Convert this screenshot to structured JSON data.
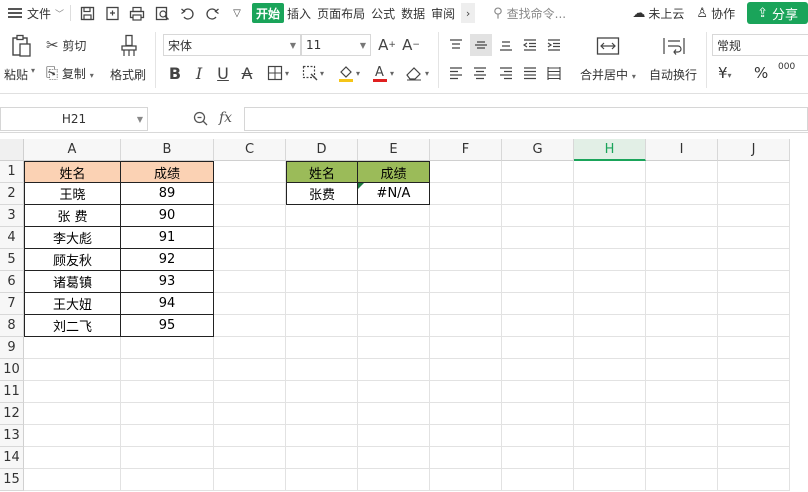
{
  "menubar": {
    "file_label": "文件",
    "tabs": [
      {
        "label": "开始",
        "active": true
      },
      {
        "label": "插入",
        "active": false
      },
      {
        "label": "页面布局",
        "active": false
      },
      {
        "label": "公式",
        "active": false
      },
      {
        "label": "数据",
        "active": false
      },
      {
        "label": "审阅",
        "active": false
      }
    ],
    "search_placeholder": "查找命令...",
    "cloud_label": "未上云",
    "collab_label": "协作",
    "share_label": "分享",
    "accent_color": "#1aa45a"
  },
  "ribbon": {
    "paste_label": "粘贴",
    "cut_label": "剪切",
    "copy_label": "复制",
    "format_painter_label": "格式刷",
    "font_name": "宋体",
    "font_size": "11",
    "merge_label": "合并居中",
    "wrap_label": "自动换行",
    "number_format": "常规",
    "currency_symbol": "¥",
    "percent_symbol": "%",
    "thousands_symbol": "000"
  },
  "formula_bar": {
    "name_box": "H21",
    "fx": "fx",
    "formula": ""
  },
  "sheet": {
    "columns": [
      "A",
      "B",
      "C",
      "D",
      "E",
      "F",
      "G",
      "H",
      "I",
      "J"
    ],
    "selected_column": "H",
    "rows": [
      "1",
      "2",
      "3",
      "4",
      "5",
      "6",
      "7",
      "8",
      "9",
      "10",
      "11",
      "12",
      "13",
      "14",
      "15"
    ],
    "table1": {
      "header": [
        "姓名",
        "成绩"
      ],
      "rows": [
        [
          "王晓",
          "89"
        ],
        [
          "张 费",
          "90"
        ],
        [
          "李大彪",
          "91"
        ],
        [
          "顾友秋",
          "92"
        ],
        [
          "诸葛镇",
          "93"
        ],
        [
          "王大妞",
          "94"
        ],
        [
          "刘二飞",
          "95"
        ]
      ],
      "header_color": "#fbd2b4"
    },
    "table2": {
      "header": [
        "姓名",
        "成绩"
      ],
      "rows": [
        [
          "张费",
          "#N/A"
        ]
      ],
      "header_color": "#9bbb59"
    }
  }
}
